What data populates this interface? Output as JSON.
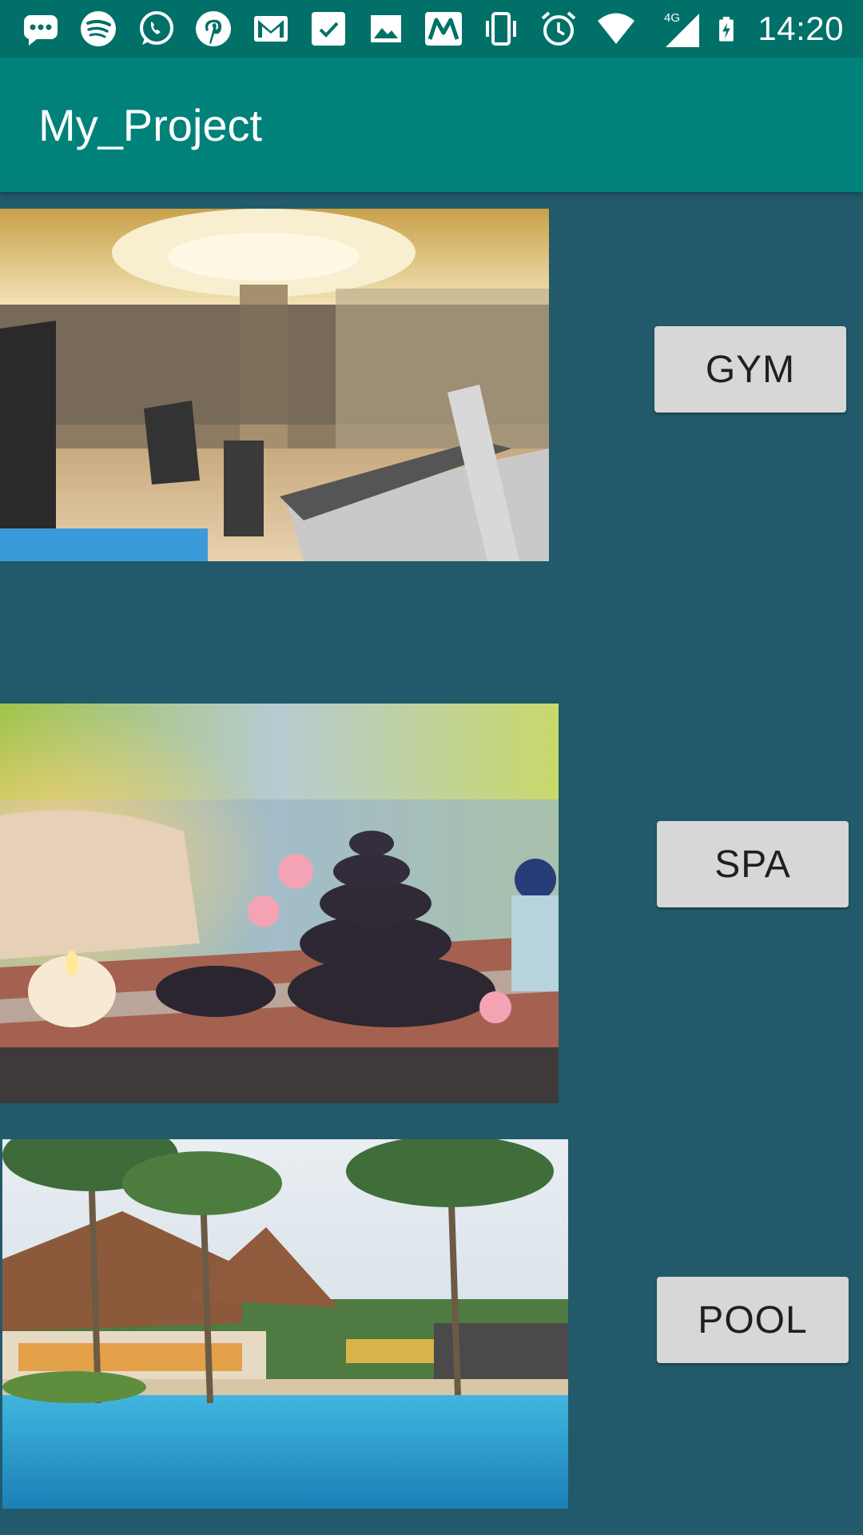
{
  "status_bar": {
    "time": "14:20",
    "network": "4G",
    "icons": [
      "messages-icon",
      "spotify-icon",
      "whatsapp-icon",
      "pinterest-icon",
      "gmail-icon",
      "tasks-icon",
      "gallery-icon",
      "moto-icon",
      "vibrate-icon",
      "alarm-icon",
      "wifi-icon",
      "cellular-signal-icon",
      "battery-charging-icon"
    ]
  },
  "app_bar": {
    "title": "My_Project"
  },
  "rows": [
    {
      "image": "gym-photo",
      "button_label": "GYM"
    },
    {
      "image": "spa-photo",
      "button_label": "SPA"
    },
    {
      "image": "pool-photo",
      "button_label": "POOL"
    }
  ],
  "colors": {
    "status_bar": "#007068",
    "app_bar": "#00827a",
    "background": "#225a6b",
    "button": "#d7d7d7"
  }
}
